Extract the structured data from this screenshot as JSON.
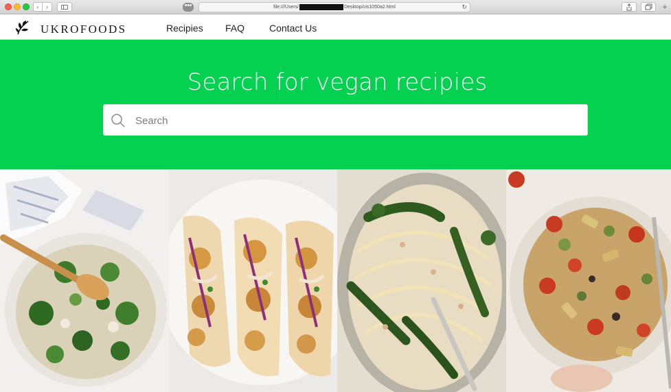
{
  "browser": {
    "url_prefix": "file:///Users/",
    "url_suffix": "Desktop/cis1050a2.html",
    "back_icon": "chevron-left-icon",
    "forward_icon": "chevron-right-icon",
    "reload_icon": "reload-icon"
  },
  "header": {
    "brand": "UKROFOODS",
    "logo_icon": "leaf-logo-icon",
    "nav": [
      {
        "label": "Recipies"
      },
      {
        "label": "FAQ"
      },
      {
        "label": "Contact Us"
      }
    ]
  },
  "hero": {
    "title": "Search for vegan recipies",
    "background_color": "#05d151",
    "search": {
      "placeholder": "Search",
      "value": "",
      "icon": "search-icon"
    }
  },
  "gallery": {
    "tiles": [
      {
        "depicts": "pasta-with-broccoli-and-spinach-in-skillet"
      },
      {
        "depicts": "cauliflower-tacos-with-red-cabbage"
      },
      {
        "depicts": "spaghetti-with-broccolini-and-almonds"
      },
      {
        "depicts": "penne-with-roasted-tomatoes-and-zucchini"
      }
    ]
  }
}
